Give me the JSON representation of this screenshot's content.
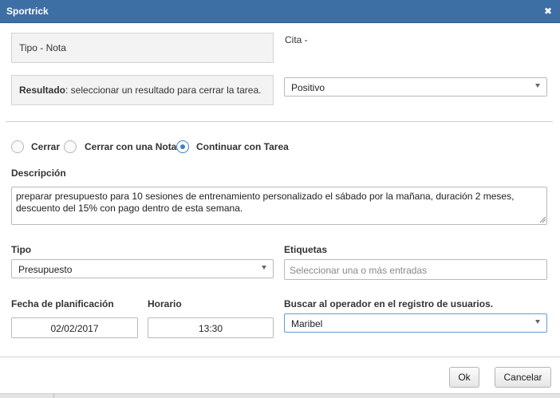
{
  "window": {
    "title": "Sportrick",
    "close_icon": "close-icon"
  },
  "header": {
    "tipo": "Tipo - Nota",
    "cita": "Cita -",
    "resultado_label": "Resultado",
    "resultado_text": ": seleccionar un resultado para cerrar la tarea.",
    "resultado_value": "Positivo"
  },
  "options": {
    "selected": "Continuar con Tarea",
    "items": [
      "Cerrar",
      "Cerrar con una Nota",
      "Continuar con Tarea"
    ]
  },
  "descripcion": {
    "label": "Descripción",
    "value": "preparar presupuesto para 10 sesiones de entrenamiento personalizado el sábado por la mañana, duración 2 meses, descuento del 15% con pago dentro de esta semana."
  },
  "tipo": {
    "label": "Tipo",
    "value": "Presupuesto"
  },
  "etiquetas": {
    "label": "Etiquetas",
    "placeholder": "Seleccionar una o más entradas"
  },
  "fecha": {
    "label": "Fecha de planificación",
    "value": "02/02/2017"
  },
  "horario": {
    "label": "Horario",
    "value": "13:30"
  },
  "operador": {
    "label": "Buscar al operador en el registro de usuarios.",
    "value": "Maribel"
  },
  "buttons": {
    "ok": "Ok",
    "cancel": "Cancelar"
  },
  "colors": {
    "titlebar": "#3d6fa5",
    "accent": "#3f7ec7"
  }
}
